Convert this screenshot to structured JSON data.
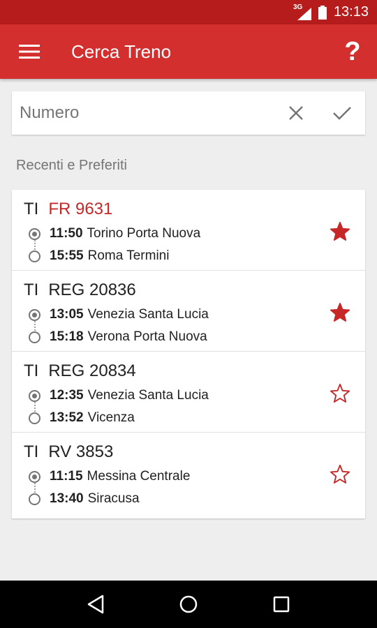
{
  "status_bar": {
    "network": "3G",
    "time": "13:13"
  },
  "app_bar": {
    "title": "Cerca Treno",
    "help": "?"
  },
  "search": {
    "placeholder": "Numero",
    "value": ""
  },
  "section_label": "Recenti e Preferiti",
  "trains": [
    {
      "company": "TI",
      "number": "FR 9631",
      "highlight": true,
      "departure": {
        "time": "11:50",
        "station": "Torino Porta Nuova"
      },
      "arrival": {
        "time": "15:55",
        "station": "Roma Termini"
      },
      "favorite": true
    },
    {
      "company": "TI",
      "number": "REG 20836",
      "highlight": false,
      "departure": {
        "time": "13:05",
        "station": "Venezia Santa Lucia"
      },
      "arrival": {
        "time": "15:18",
        "station": "Verona Porta Nuova"
      },
      "favorite": true
    },
    {
      "company": "TI",
      "number": "REG 20834",
      "highlight": false,
      "departure": {
        "time": "12:35",
        "station": "Venezia Santa Lucia"
      },
      "arrival": {
        "time": "13:52",
        "station": "Vicenza"
      },
      "favorite": false
    },
    {
      "company": "TI",
      "number": "RV 3853",
      "highlight": false,
      "departure": {
        "time": "11:15",
        "station": "Messina Centrale"
      },
      "arrival": {
        "time": "13:40",
        "station": "Siracusa"
      },
      "favorite": false
    }
  ],
  "colors": {
    "primary": "#d32f2f",
    "primary_dark": "#b71c1c",
    "accent": "#c62828"
  },
  "icons": {
    "menu": "hamburger-icon",
    "help": "question-icon",
    "clear": "close-icon",
    "confirm": "check-icon",
    "favorite_on": "star-filled-icon",
    "favorite_off": "star-outline-icon",
    "back": "back-triangle-icon",
    "home": "home-circle-icon",
    "recents": "recents-square-icon"
  }
}
